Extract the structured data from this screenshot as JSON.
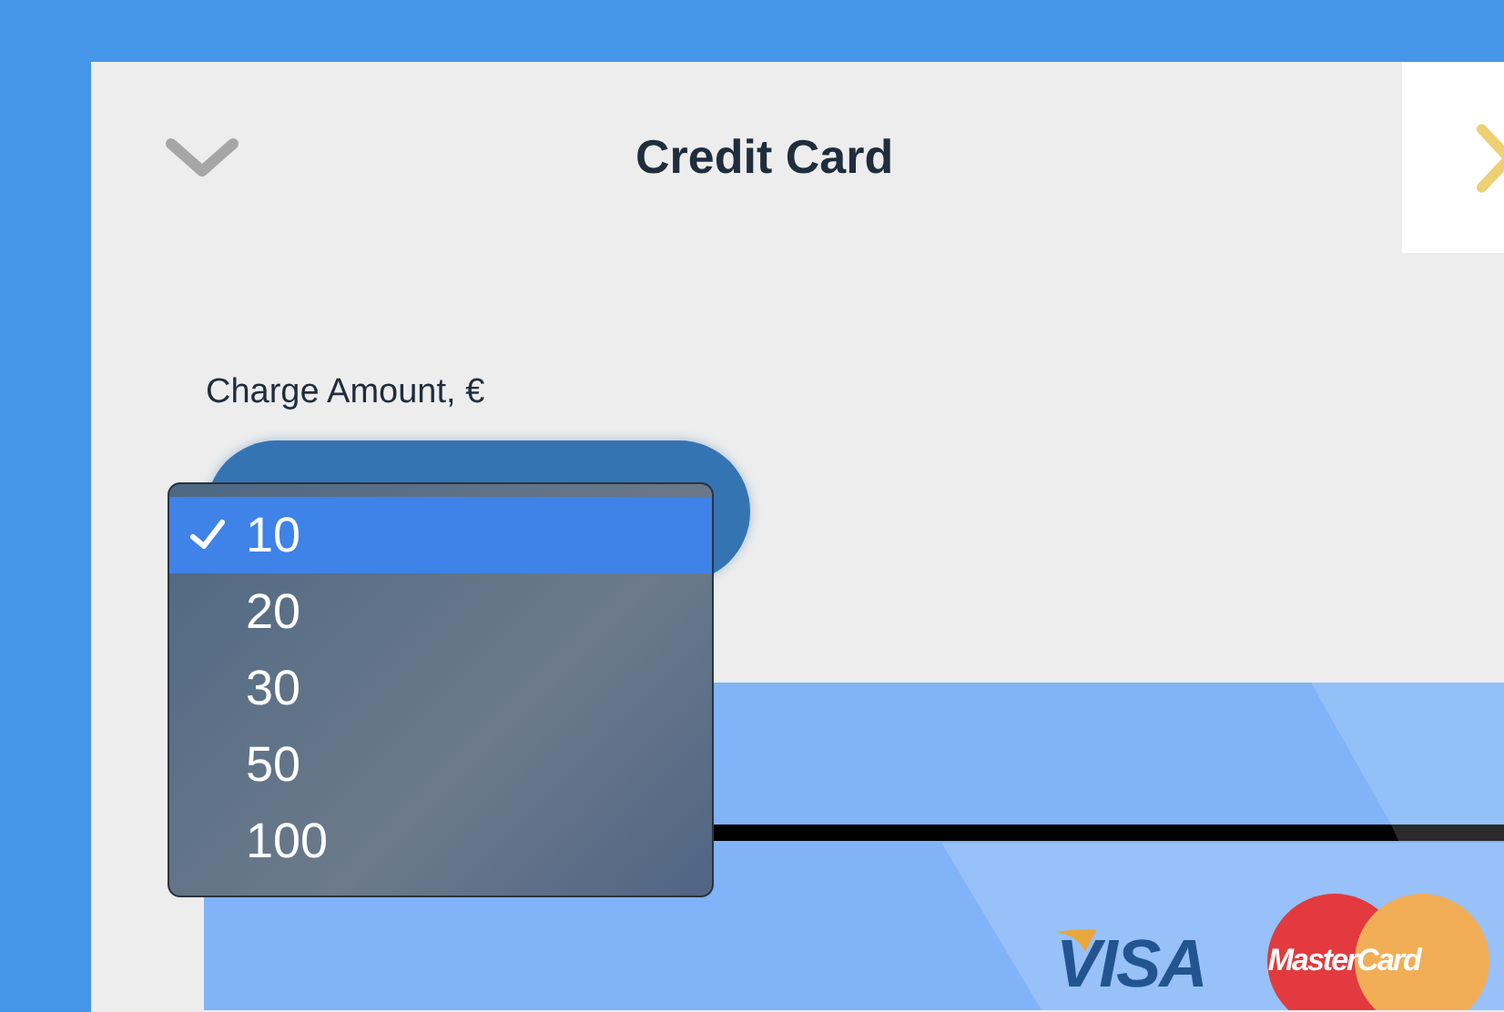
{
  "header": {
    "title": "Credit Card"
  },
  "charge": {
    "label": "Charge Amount, €"
  },
  "amount_menu": {
    "options": [
      {
        "label": "10",
        "selected": true
      },
      {
        "label": "20",
        "selected": false
      },
      {
        "label": "30",
        "selected": false
      },
      {
        "label": "50",
        "selected": false
      },
      {
        "label": "100",
        "selected": false
      }
    ]
  },
  "card": {
    "brands": [
      {
        "kind": "visa",
        "label": "VISA"
      },
      {
        "kind": "mastercard",
        "label": "MasterCard"
      }
    ]
  }
}
